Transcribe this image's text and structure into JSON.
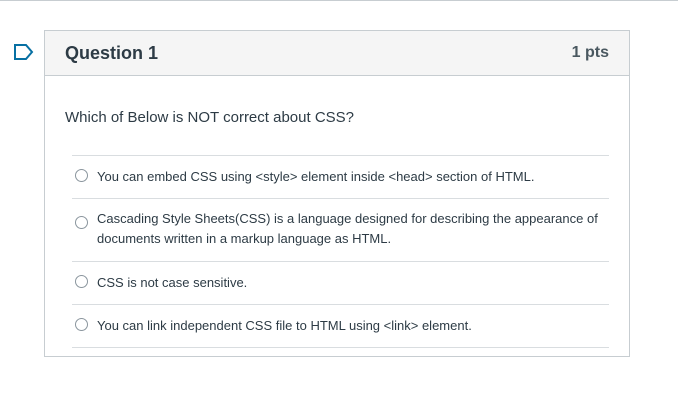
{
  "question": {
    "title": "Question 1",
    "points": "1 pts",
    "text": "Which of Below is NOT correct about CSS?",
    "answers": [
      "You can embed CSS using <style> element inside <head> section of HTML.",
      "Cascading Style Sheets(CSS) is a language designed for describing the appearance of documents written in a markup language as HTML.",
      "CSS is not case sensitive.",
      "You can link independent CSS file to HTML using <link> element."
    ],
    "selected": null
  },
  "icons": {
    "flag": "flag-icon",
    "radio": "radio-icon"
  },
  "colors": {
    "flag_accent": "#0770a3",
    "border": "#c7cdd1",
    "header_bg": "#f5f5f5",
    "text": "#2d3b45"
  }
}
